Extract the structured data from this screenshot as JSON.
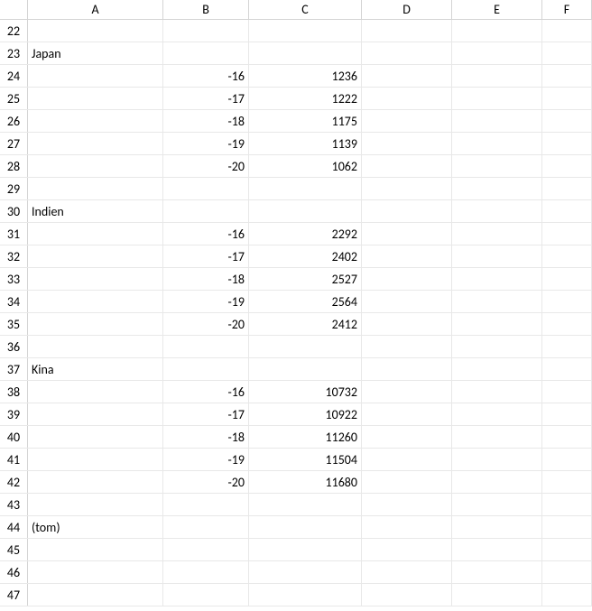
{
  "columns": [
    "A",
    "B",
    "C",
    "D",
    "E",
    "F"
  ],
  "startRow": 22,
  "endRow": 47,
  "cells": {
    "23": {
      "A": "Japan"
    },
    "24": {
      "B": "-16",
      "C": "1236"
    },
    "25": {
      "B": "-17",
      "C": "1222"
    },
    "26": {
      "B": "-18",
      "C": "1175"
    },
    "27": {
      "B": "-19",
      "C": "1139"
    },
    "28": {
      "B": "-20",
      "C": "1062"
    },
    "30": {
      "A": "Indien"
    },
    "31": {
      "B": "-16",
      "C": "2292"
    },
    "32": {
      "B": "-17",
      "C": "2402"
    },
    "33": {
      "B": "-18",
      "C": "2527"
    },
    "34": {
      "B": "-19",
      "C": "2564"
    },
    "35": {
      "B": "-20",
      "C": "2412"
    },
    "37": {
      "A": "Kina"
    },
    "38": {
      "B": "-16",
      "C": "10732"
    },
    "39": {
      "B": "-17",
      "C": "10922"
    },
    "40": {
      "B": "-18",
      "C": "11260"
    },
    "41": {
      "B": "-19",
      "C": "11504"
    },
    "42": {
      "B": "-20",
      "C": "11680"
    },
    "44": {
      "A": "(tom)"
    }
  }
}
